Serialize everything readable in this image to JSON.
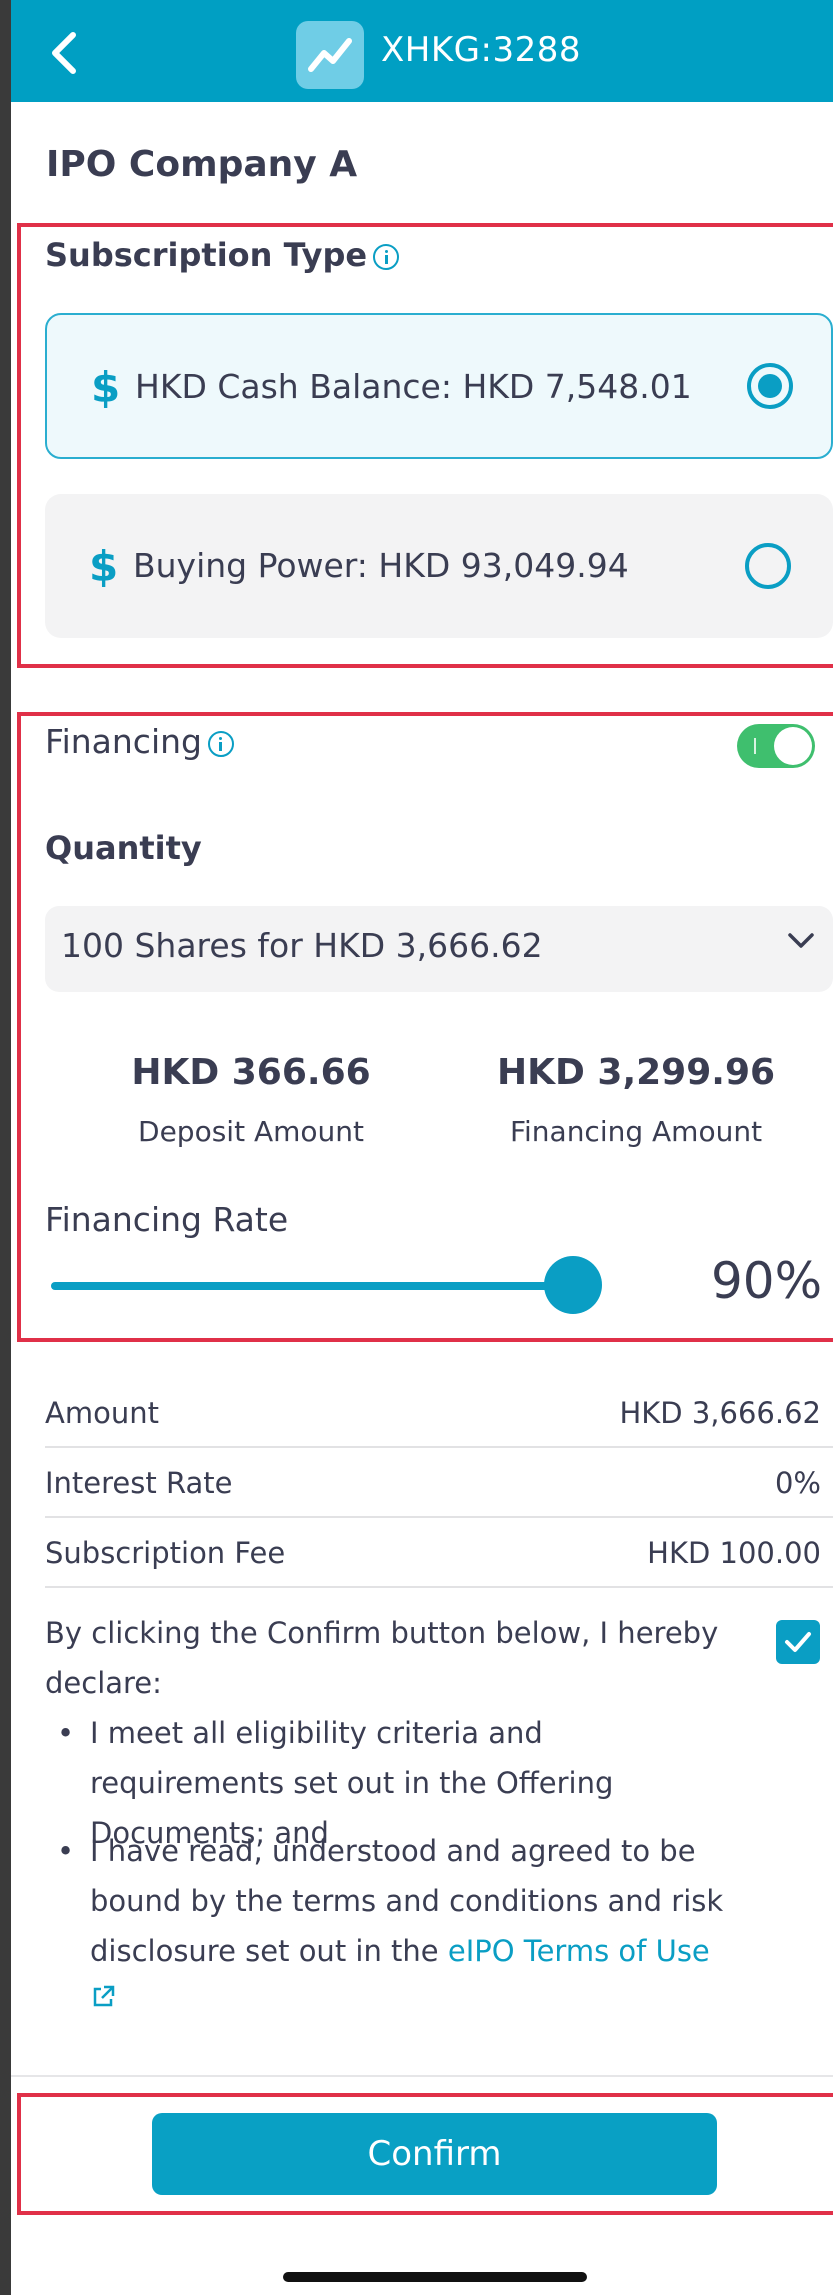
{
  "header": {
    "title": "XHKG:3288",
    "back_icon": "chevron-left-icon",
    "logo_icon": "trend-chart-icon"
  },
  "company": {
    "name": "IPO Company A"
  },
  "subscription": {
    "title": "Subscription Type",
    "options": [
      {
        "label": "HKD Cash Balance: HKD 7,548.01",
        "selected": true,
        "icon": "dollar-icon"
      },
      {
        "label": "Buying Power: HKD 93,049.94",
        "selected": false,
        "icon": "dollar-icon"
      }
    ]
  },
  "financing": {
    "label": "Financing",
    "enabled": true,
    "quantity_title": "Quantity",
    "quantity_value": "100 Shares for HKD 3,666.62",
    "deposit_value": "HKD 366.66",
    "deposit_label": "Deposit Amount",
    "financing_value": "HKD 3,299.96",
    "financing_label": "Financing Amount",
    "rate_label": "Financing Rate",
    "rate_value": "90%",
    "rate_fraction": 0.9
  },
  "summary": [
    {
      "label": "Amount",
      "value": "HKD 3,666.62"
    },
    {
      "label": "Interest Rate",
      "value": "0%"
    },
    {
      "label": "Subscription Fee",
      "value": "HKD 100.00"
    }
  ],
  "declaration": {
    "intro": "By clicking the Confirm button below, I hereby declare:",
    "checked": true,
    "bullet1": "I meet all eligibility criteria and requirements set out in the Offering Documents; and",
    "bullet2": "I have read, understood and agreed to be bound by the terms and conditions and risk disclosure set out in the",
    "link": "eIPO Terms of Use"
  },
  "confirm_label": "Confirm",
  "colors": {
    "brand": "#009fc3",
    "toggle_on": "#3fbf6e",
    "highlight": "#e03048"
  }
}
